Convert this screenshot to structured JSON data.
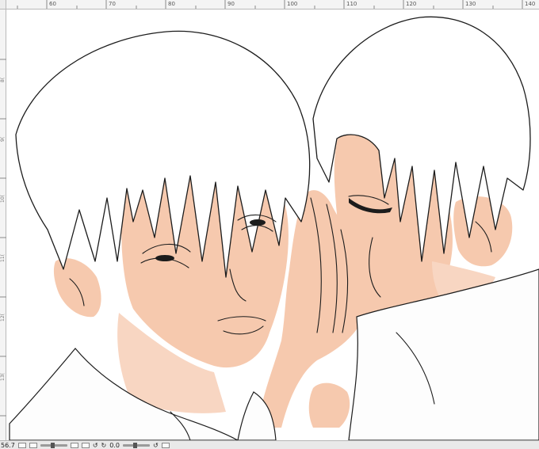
{
  "ruler_top": [
    "60",
    "70",
    "80",
    "90",
    "100",
    "110",
    "120",
    "130",
    "140"
  ],
  "ruler_left": [
    "8(",
    "9(",
    "10(",
    "11(",
    "12(",
    "13("
  ],
  "status": {
    "zoom": "56.7",
    "angle": "0.0"
  },
  "colors": {
    "skin": "#f6c9ae",
    "line": "#1c1c1c",
    "hair": "#ffffff",
    "ruler": "#f4f4f4"
  }
}
